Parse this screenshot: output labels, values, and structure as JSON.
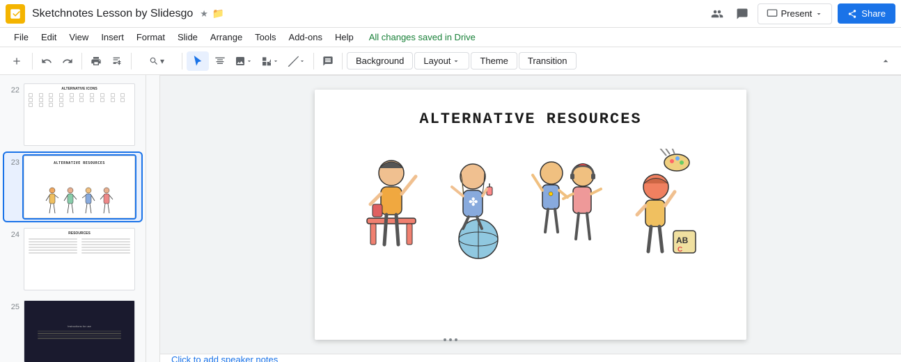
{
  "app": {
    "icon_color": "#f4b400",
    "title": "Sketchnotes Lesson by Slidesgo",
    "saved_notice": "All changes saved in Drive"
  },
  "menu": {
    "items": [
      "File",
      "Edit",
      "View",
      "Insert",
      "Format",
      "Slide",
      "Arrange",
      "Tools",
      "Add-ons",
      "Help"
    ]
  },
  "toolbar": {
    "background_label": "Background",
    "layout_label": "Layout",
    "theme_label": "Theme",
    "transition_label": "Transition"
  },
  "top_right": {
    "present_label": "Present",
    "share_label": "Share"
  },
  "sidebar": {
    "slides": [
      {
        "num": "22",
        "type": "icons"
      },
      {
        "num": "23",
        "type": "active"
      },
      {
        "num": "24",
        "type": "resources"
      },
      {
        "num": "25",
        "type": "dark"
      }
    ]
  },
  "slide": {
    "title": "ALTERNATIVE RESOURCES"
  },
  "speaker_notes": {
    "placeholder": "Click to add speaker notes"
  }
}
